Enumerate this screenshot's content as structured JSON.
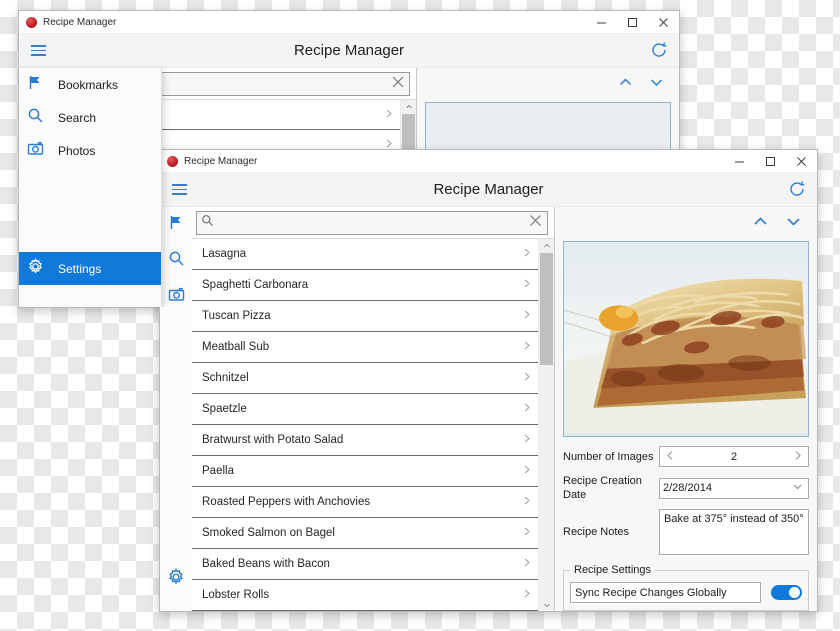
{
  "background": {
    "type": "transparency-checkerboard",
    "light": "#ffffff",
    "dark": "#e8e8e8"
  },
  "colors": {
    "accent": "#2b7cd3",
    "selected": "#0f7ad9",
    "toggle_on": "#0f7ad9",
    "list_divider": "#6b6b6b",
    "photo_border": "#8fb4d9"
  },
  "window_one": {
    "titlebar": {
      "app_name": "Recipe Manager",
      "icon": "app-icon",
      "minimize": "minimize-icon",
      "maximize": "maximize-icon",
      "close": "close-icon"
    },
    "header": {
      "menu_icon": "hamburger-icon",
      "title": "Recipe Manager",
      "refresh_icon": "refresh-icon"
    },
    "flyout": {
      "items": [
        {
          "label": "Bookmarks",
          "icon": "flag-icon",
          "selected": false
        },
        {
          "label": "Search",
          "icon": "search-icon",
          "selected": false
        },
        {
          "label": "Photos",
          "icon": "camera-icon",
          "selected": false
        }
      ],
      "footer": {
        "label": "Settings",
        "icon": "gear-icon",
        "selected": true
      }
    },
    "search": {
      "value": "",
      "placeholder": "",
      "clear_icon": "clear-icon",
      "search_icon": "search-icon"
    },
    "list": {
      "items": [
        "",
        ""
      ]
    },
    "detail": {
      "prev_icon": "chevron-up-icon",
      "next_icon": "chevron-down-icon",
      "photo": "lasagna-photo"
    }
  },
  "window_two": {
    "titlebar": {
      "app_name": "Recipe Manager",
      "icon": "app-icon",
      "minimize": "minimize-icon",
      "maximize": "maximize-icon",
      "close": "close-icon"
    },
    "header": {
      "menu_icon": "hamburger-icon",
      "title": "Recipe Manager",
      "refresh_icon": "refresh-icon"
    },
    "rail": {
      "icons": [
        "flag-icon",
        "search-icon",
        "camera-icon"
      ],
      "footer_icon": "gear-icon"
    },
    "search": {
      "value": "",
      "placeholder": "",
      "search_icon": "search-icon",
      "clear_icon": "clear-icon"
    },
    "list": {
      "items": [
        "Lasagna",
        "Spaghetti Carbonara",
        "Tuscan Pizza",
        "Meatball Sub",
        "Schnitzel",
        "Spaetzle",
        "Bratwurst with Potato Salad",
        "Paella",
        "Roasted Peppers with Anchovies",
        "Smoked Salmon on Bagel",
        "Baked Beans with Bacon",
        "Lobster Rolls"
      ],
      "scrollbar": {
        "up_icon": "scroll-up-icon",
        "down_icon": "scroll-down-icon"
      }
    },
    "detail": {
      "prev_icon": "chevron-up-icon",
      "next_icon": "chevron-down-icon",
      "photo": "lasagna-photo",
      "fields": {
        "images_label": "Number of Images",
        "images_value": "2",
        "images_prev_icon": "chevron-left-icon",
        "images_next_icon": "chevron-right-icon",
        "date_label": "Recipe Creation Date",
        "date_value": "2/28/2014",
        "date_caret_icon": "chevron-down-icon",
        "notes_label": "Recipe Notes",
        "notes_value": "Bake at 375° instead of 350°"
      },
      "settings_group": {
        "legend": "Recipe Settings",
        "toggle_label": "Sync Recipe Changes Globally",
        "toggle_on": true
      }
    }
  }
}
